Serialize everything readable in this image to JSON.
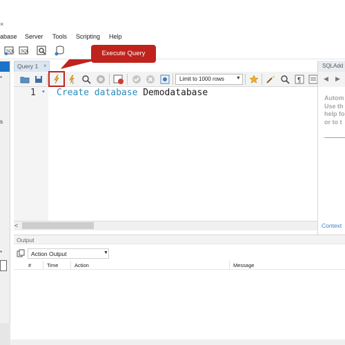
{
  "window": {
    "close_glyph": "×"
  },
  "menu": {
    "items": [
      "abase",
      "Server",
      "Tools",
      "Scripting",
      "Help"
    ]
  },
  "main_toolbar": {
    "icons": [
      "new-sql-tab-icon",
      "open-sql-file-icon",
      "inspector-icon",
      "create-schema-icon"
    ]
  },
  "editor": {
    "tab_label": "Query 1",
    "tab_close": "×",
    "limit_label": "Limit to 1000 rows",
    "line_number": "1",
    "code_keyword": "Create database",
    "code_name": "Demodatabase",
    "callout": "Execute Query",
    "toolbar_icons": [
      "open-icon",
      "save-icon",
      "execute-icon",
      "execute-current-icon",
      "explain-icon",
      "stop-icon",
      "toggle-continue-icon",
      "commit-icon",
      "rollback-icon",
      "autocommit-icon",
      "limit-dropdown",
      "beautify-icon",
      "find-icon",
      "invisible-chars-icon",
      "wrap-icon"
    ]
  },
  "right_panel": {
    "title": "SQLAdd",
    "text_lines": [
      "Autom",
      "Use th",
      "help fo",
      "or to t"
    ],
    "context_label": "Context"
  },
  "left_sidebar": {
    "fragments": [
      "*",
      "s",
      "*"
    ]
  },
  "output": {
    "header": "Output",
    "mode": "Action Output",
    "columns": [
      "#",
      "Time",
      "Action",
      "Message"
    ]
  },
  "colors": {
    "accent_red": "#c0221c",
    "keyword_blue": "#2b8bb8",
    "selection_blue": "#1a73c9"
  }
}
